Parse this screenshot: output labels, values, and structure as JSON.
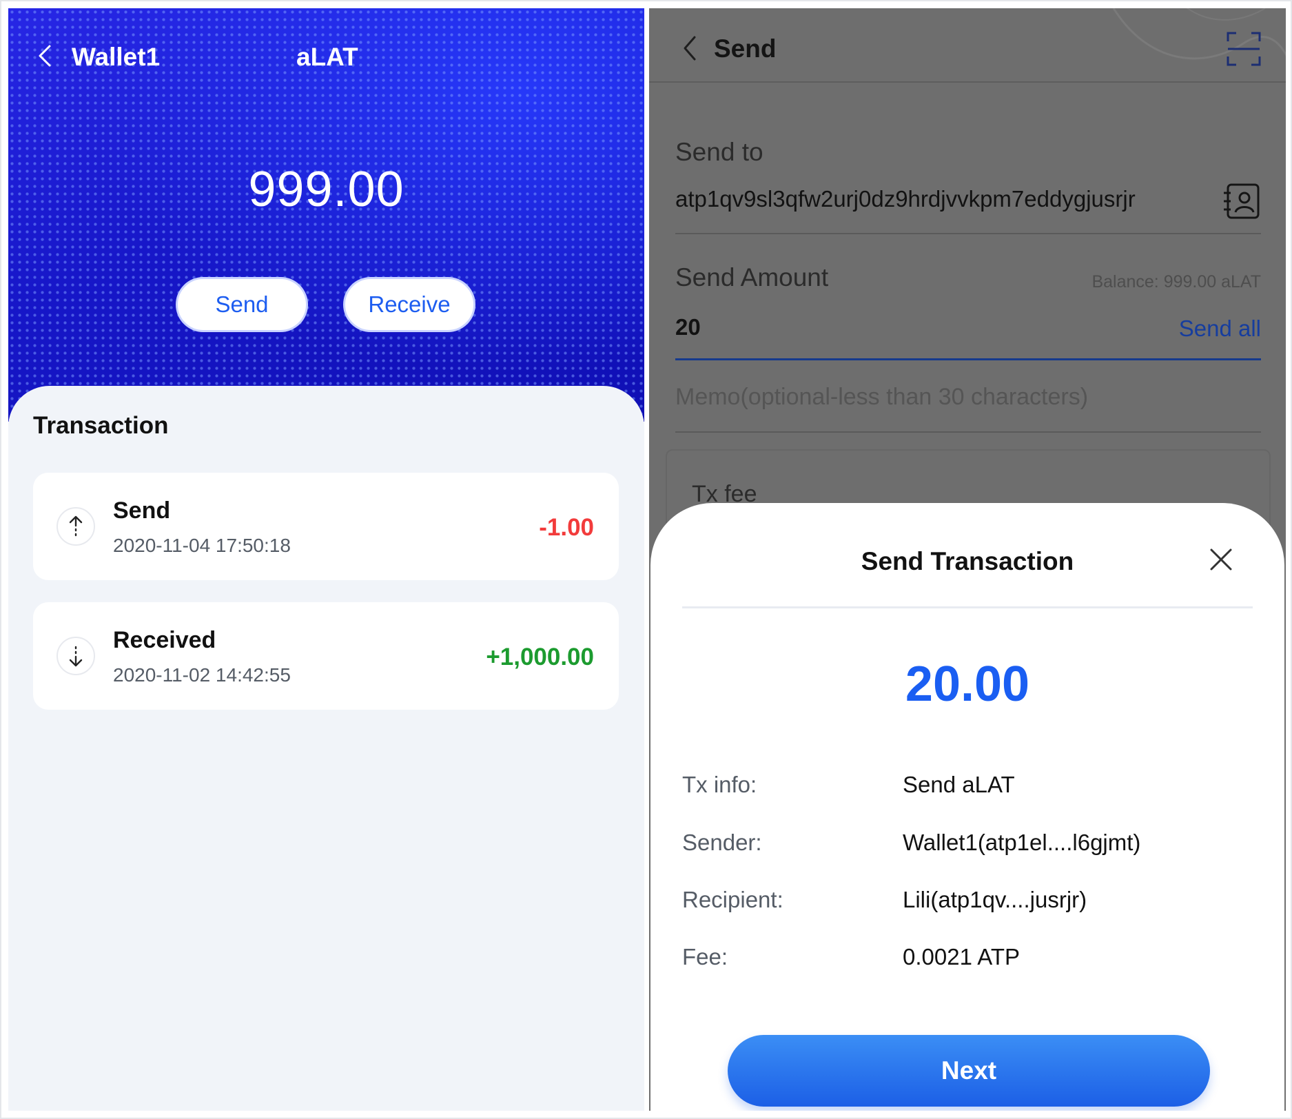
{
  "wallet_screen": {
    "wallet_name": "Wallet1",
    "token": "aLAT",
    "balance": "999.00",
    "send_label": "Send",
    "receive_label": "Receive",
    "transactions_title": "Transaction",
    "transactions": [
      {
        "type": "Send",
        "time": "2020-11-04 17:50:18",
        "amount": "-1.00",
        "direction": "up-arrow-icon"
      },
      {
        "type": "Received",
        "time": "2020-11-02 14:42:55",
        "amount": "+1,000.00",
        "direction": "down-arrow-icon"
      }
    ]
  },
  "send_screen": {
    "title": "Send",
    "send_to_label": "Send to",
    "recipient_address": "atp1qv9sl3qfw2urj0dz9hrdjvvkpm7eddygjusrjr",
    "amount_label": "Send Amount",
    "balance_hint": "Balance: 999.00 aLAT",
    "amount_value": "20",
    "send_all_label": "Send all",
    "memo_placeholder": "Memo(optional-less than 30 characters)",
    "tx_fee_label": "Tx fee"
  },
  "confirm_modal": {
    "title": "Send Transaction",
    "amount": "20.00",
    "rows": [
      {
        "key": "Tx info:",
        "value": "Send aLAT"
      },
      {
        "key": "Sender:",
        "value": "Wallet1(atp1el....l6gjmt)"
      },
      {
        "key": "Recipient:",
        "value": "Lili(atp1qv....jusrjr)"
      },
      {
        "key": "Fee:",
        "value": "0.0021 ATP"
      }
    ],
    "next_label": "Next"
  },
  "colors": {
    "brand_blue": "#1d5df0",
    "hero_blue": "#1414c8",
    "negative": "#f23b3b",
    "positive": "#1c9b2f",
    "overlay_gray": "#6e6e6e"
  }
}
